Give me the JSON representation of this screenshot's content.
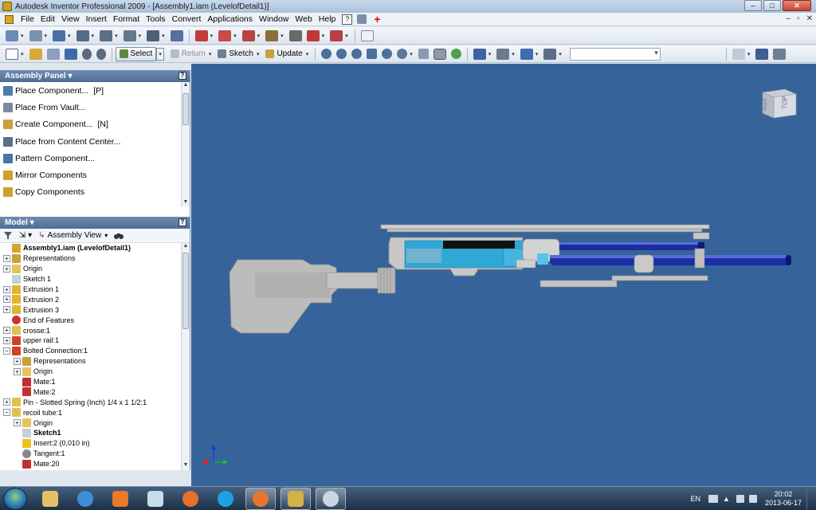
{
  "window": {
    "title": "Autodesk Inventor Professional 2009 - [Assembly1.iam (LevelofDetail1)]",
    "controls": {
      "minimize": "–",
      "maximize": "□",
      "close": "✕"
    }
  },
  "menubar": {
    "items": [
      "File",
      "Edit",
      "View",
      "Insert",
      "Format",
      "Tools",
      "Convert",
      "Applications",
      "Window",
      "Web",
      "Help"
    ],
    "mdi_controls": {
      "minimize": "–",
      "restore": "▫",
      "close": "✕"
    }
  },
  "toolbar2": {
    "select_label": "Select",
    "return_label": "Return",
    "sketch_label": "Sketch",
    "update_label": "Update"
  },
  "assembly_panel": {
    "title": "Assembly Panel ▾",
    "help": "?",
    "items": [
      {
        "label": "Place Component...",
        "shortcut": "[P]",
        "icon": "place-component-icon"
      },
      {
        "label": "Place From Vault...",
        "shortcut": "",
        "icon": "vault-icon"
      },
      {
        "label": "Create Component...",
        "shortcut": "[N]",
        "icon": "create-component-icon"
      },
      {
        "label": "Place from Content Center...",
        "shortcut": "",
        "icon": "content-center-icon"
      },
      {
        "label": "Pattern Component...",
        "shortcut": "",
        "icon": "pattern-icon"
      },
      {
        "label": "Mirror Components",
        "shortcut": "",
        "icon": "mirror-icon"
      },
      {
        "label": "Copy Components",
        "shortcut": "",
        "icon": "copy-icon"
      }
    ]
  },
  "model_panel": {
    "title": "Model ▾",
    "help": "?",
    "view_label": "Assembly View",
    "tree": [
      {
        "label": "Assembly1.iam (LevelofDetail1)",
        "level": 0,
        "exp": "",
        "icon": "assembly-icon",
        "bold": true
      },
      {
        "label": "Representations",
        "level": 0,
        "exp": "+",
        "icon": "representations-icon"
      },
      {
        "label": "Origin",
        "level": 0,
        "exp": "+",
        "icon": "folder-icon"
      },
      {
        "label": "Sketch 1",
        "level": 0,
        "exp": "",
        "icon": "sketch-icon"
      },
      {
        "label": "Extrusion 1",
        "level": 0,
        "exp": "+",
        "icon": "extrusion-icon"
      },
      {
        "label": "Extrusion 2",
        "level": 0,
        "exp": "+",
        "icon": "extrusion-icon"
      },
      {
        "label": "Extrusion 3",
        "level": 0,
        "exp": "+",
        "icon": "extrusion-icon"
      },
      {
        "label": "End of Features",
        "level": 0,
        "exp": "",
        "icon": "end-of-features-icon"
      },
      {
        "label": "crosse:1",
        "level": 0,
        "exp": "+",
        "icon": "part-icon"
      },
      {
        "label": "upper rail:1",
        "level": 0,
        "exp": "+",
        "icon": "part-update-icon"
      },
      {
        "label": "Bolted Connection:1",
        "level": 0,
        "exp": "−",
        "icon": "bolted-connection-icon"
      },
      {
        "label": "Representations",
        "level": 1,
        "exp": "+",
        "icon": "representations-icon"
      },
      {
        "label": "Origin",
        "level": 1,
        "exp": "+",
        "icon": "folder-icon"
      },
      {
        "label": "Mate:1",
        "level": 1,
        "exp": "",
        "icon": "mate-icon"
      },
      {
        "label": "Mate:2",
        "level": 1,
        "exp": "",
        "icon": "mate-icon"
      },
      {
        "label": "Pin - Slotted Spring (Inch) 1/4 x 1 1/2:1",
        "level": 0,
        "exp": "+",
        "icon": "part-icon"
      },
      {
        "label": "recoil tube:1",
        "level": 0,
        "exp": "−",
        "icon": "part-icon"
      },
      {
        "label": "Origin",
        "level": 1,
        "exp": "+",
        "icon": "folder-icon"
      },
      {
        "label": "Sketch1",
        "level": 1,
        "exp": "",
        "icon": "sketch-icon",
        "bold": true
      },
      {
        "label": "Insert:2 (0,010 in)",
        "level": 1,
        "exp": "",
        "icon": "insert-warning-icon"
      },
      {
        "label": "Tangent:1",
        "level": 1,
        "exp": "",
        "icon": "tangent-icon"
      },
      {
        "label": "Mate:20",
        "level": 1,
        "exp": "",
        "icon": "mate-icon"
      }
    ]
  },
  "viewcube": {
    "top_label": "TOP",
    "right_label": "RIGHT"
  },
  "taskbar": {
    "apps": [
      "windows-explorer",
      "internet-explorer",
      "media-player",
      "notepad",
      "firefox",
      "skype",
      "firefox-2",
      "inventor",
      "paint"
    ],
    "active_app": "inventor",
    "language": "EN",
    "time": "20:02",
    "date": "2013-06-17"
  },
  "colors": {
    "viewport_bg": "#36649a",
    "stock_gray": "#b9b9b9",
    "part_cyan": "#2fa8d8",
    "barrel_blue": "#1b2c9e"
  }
}
